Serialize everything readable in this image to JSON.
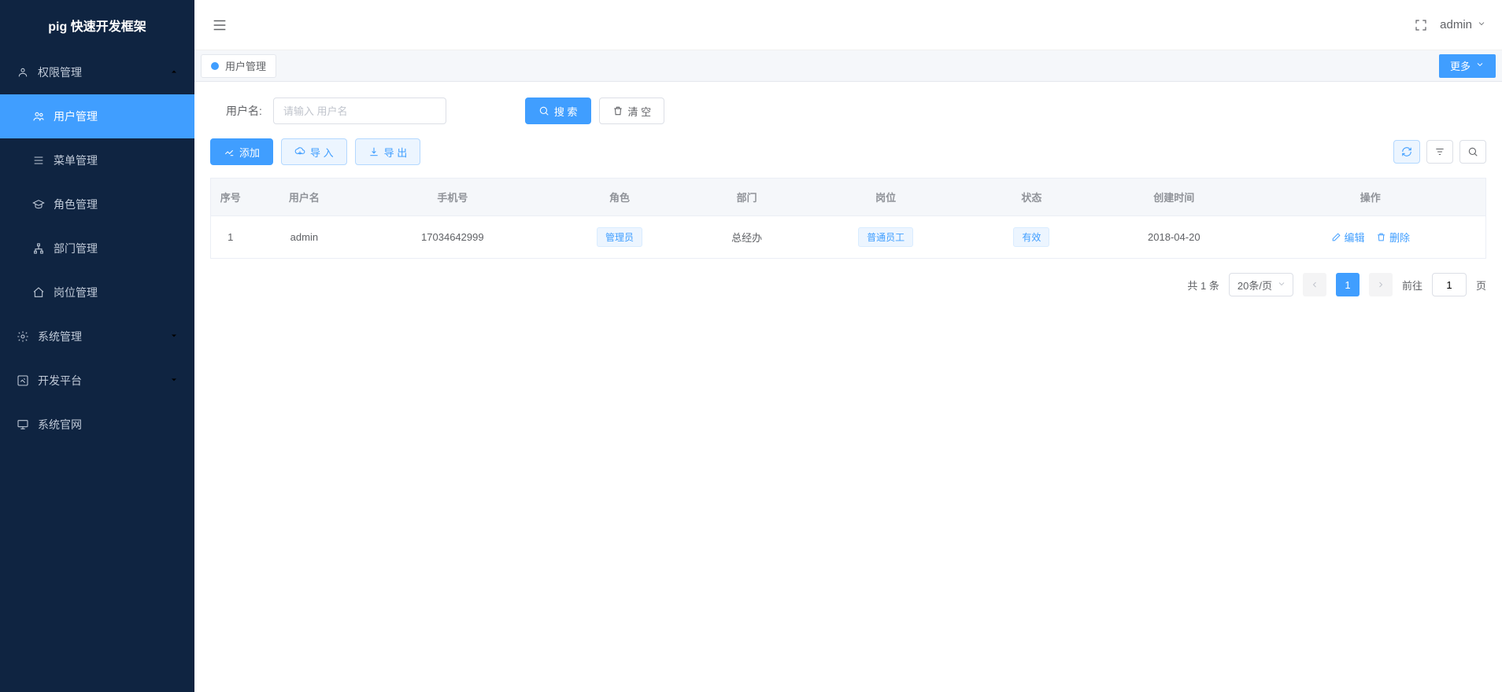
{
  "sidebar": {
    "logo": "pig 快速开发框架",
    "groups": [
      {
        "label": "权限管理",
        "expanded": true,
        "children": [
          {
            "label": "用户管理",
            "active": true,
            "icon": "users"
          },
          {
            "label": "菜单管理",
            "icon": "list"
          },
          {
            "label": "角色管理",
            "icon": "graduation"
          },
          {
            "label": "部门管理",
            "icon": "tree"
          },
          {
            "label": "岗位管理",
            "icon": "home"
          }
        ]
      },
      {
        "label": "系统管理",
        "expanded": false,
        "icon": "gear"
      },
      {
        "label": "开发平台",
        "expanded": false,
        "icon": "edit-square"
      },
      {
        "label": "系统官网",
        "expanded": null,
        "icon": "monitor"
      }
    ]
  },
  "topbar": {
    "user": "admin"
  },
  "tabs": {
    "active": "用户管理",
    "more": "更多"
  },
  "search": {
    "label": "用户名:",
    "placeholder": "请输入 用户名",
    "search_btn": "搜 索",
    "clear_btn": "清 空"
  },
  "actions": {
    "add": "添加",
    "import": "导 入",
    "export": "导 出"
  },
  "table": {
    "columns": [
      "序号",
      "用户名",
      "手机号",
      "角色",
      "部门",
      "岗位",
      "状态",
      "创建时间",
      "操作"
    ],
    "rows": [
      {
        "index": "1",
        "username": "admin",
        "phone": "17034642999",
        "role": "管理员",
        "dept": "总经办",
        "post": "普通员工",
        "status": "有效",
        "created": "2018-04-20"
      }
    ],
    "edit": "编辑",
    "delete": "删除"
  },
  "pagination": {
    "total_label": "共 1 条",
    "page_size": "20条/页",
    "current": "1",
    "jump_prefix": "前往",
    "jump_value": "1",
    "jump_suffix": "页"
  }
}
